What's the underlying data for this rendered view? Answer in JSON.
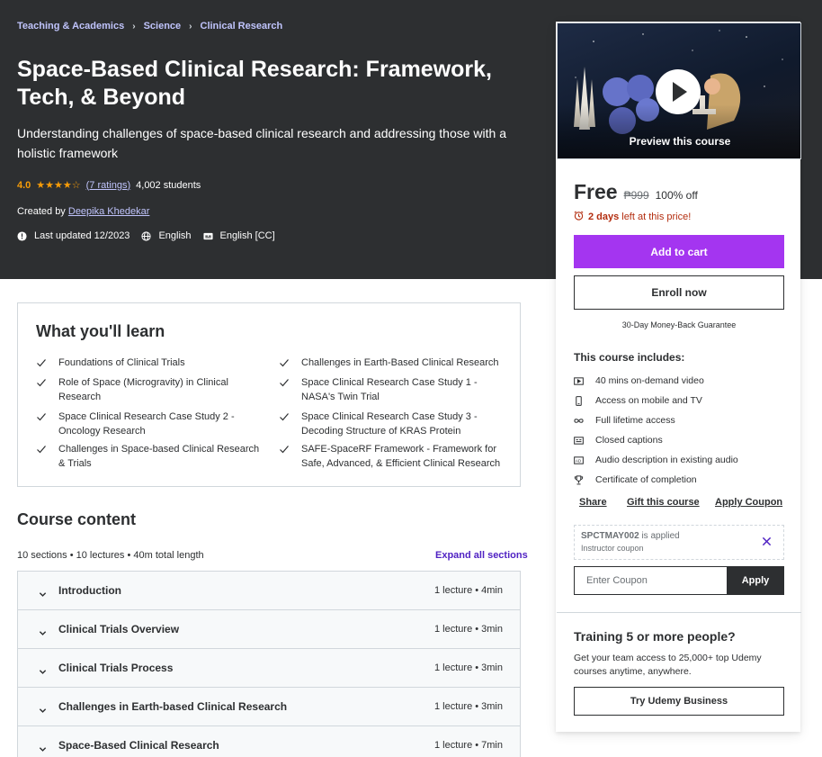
{
  "breadcrumb": [
    "Teaching & Academics",
    "Science",
    "Clinical Research"
  ],
  "course": {
    "title": "Space-Based Clinical Research: Framework, Tech, & Beyond",
    "subtitle": "Understanding challenges of space-based clinical research and addressing those with a holistic framework",
    "rating": "4.0",
    "stars": "★★★★☆",
    "ratings_count": "(7 ratings)",
    "students": "4,002 students",
    "created_by_label": "Created by",
    "instructor": "Deepika Khedekar",
    "last_updated": "Last updated 12/2023",
    "language": "English",
    "captions": "English [CC]"
  },
  "learn": {
    "title": "What you'll learn",
    "items": [
      "Foundations of Clinical Trials",
      "Challenges in Earth-Based Clinical Research",
      "Role of Space (Microgravity) in Clinical Research",
      "Space Clinical Research Case Study 1 - NASA's Twin Trial",
      "Space Clinical Research Case Study 2 - Oncology Research",
      "Space Clinical Research Case Study 3 - Decoding Structure of KRAS Protein",
      "Challenges in Space-based Clinical Research & Trials",
      "SAFE-SpaceRF Framework - Framework for Safe, Advanced, & Efficient Clinical Research"
    ]
  },
  "content": {
    "title": "Course content",
    "meta": "10 sections • 10 lectures • 40m total length",
    "expand_label": "Expand all sections",
    "sections": [
      {
        "name": "Introduction",
        "info": "1 lecture • 4min"
      },
      {
        "name": "Clinical Trials Overview",
        "info": "1 lecture • 3min"
      },
      {
        "name": "Clinical Trials Process",
        "info": "1 lecture • 3min"
      },
      {
        "name": "Challenges in Earth-based Clinical Research",
        "info": "1 lecture • 3min"
      },
      {
        "name": "Space-Based Clinical Research",
        "info": "1 lecture • 7min"
      }
    ]
  },
  "sidebar": {
    "preview_label": "Preview this course",
    "price": "Free",
    "original_price": "₱999",
    "discount": "100% off",
    "timer_bold": "2 days",
    "timer_rest": "left at this price!",
    "add_to_cart": "Add to cart",
    "enroll": "Enroll now",
    "guarantee": "30-Day Money-Back Guarantee",
    "includes_title": "This course includes:",
    "includes": [
      "40 mins on-demand video",
      "Access on mobile and TV",
      "Full lifetime access",
      "Closed captions",
      "Audio description in existing audio",
      "Certificate of completion"
    ],
    "share": "Share",
    "gift": "Gift this course",
    "apply_coupon": "Apply Coupon",
    "coupon_code": "SPCTMAY002",
    "coupon_applied": "is applied",
    "coupon_sub": "Instructor coupon",
    "coupon_placeholder": "Enter Coupon",
    "apply": "Apply",
    "team_title": "Training 5 or more people?",
    "team_desc": "Get your team access to 25,000+ top Udemy courses anytime, anywhere.",
    "business": "Try Udemy Business"
  },
  "colors": {
    "hero_bg": "#2d2f31",
    "accent": "#a435f0",
    "breadcrumb": "#c0c4fc",
    "star": "#f69c08",
    "timer": "#b32d0f",
    "link": "#5022c3"
  }
}
